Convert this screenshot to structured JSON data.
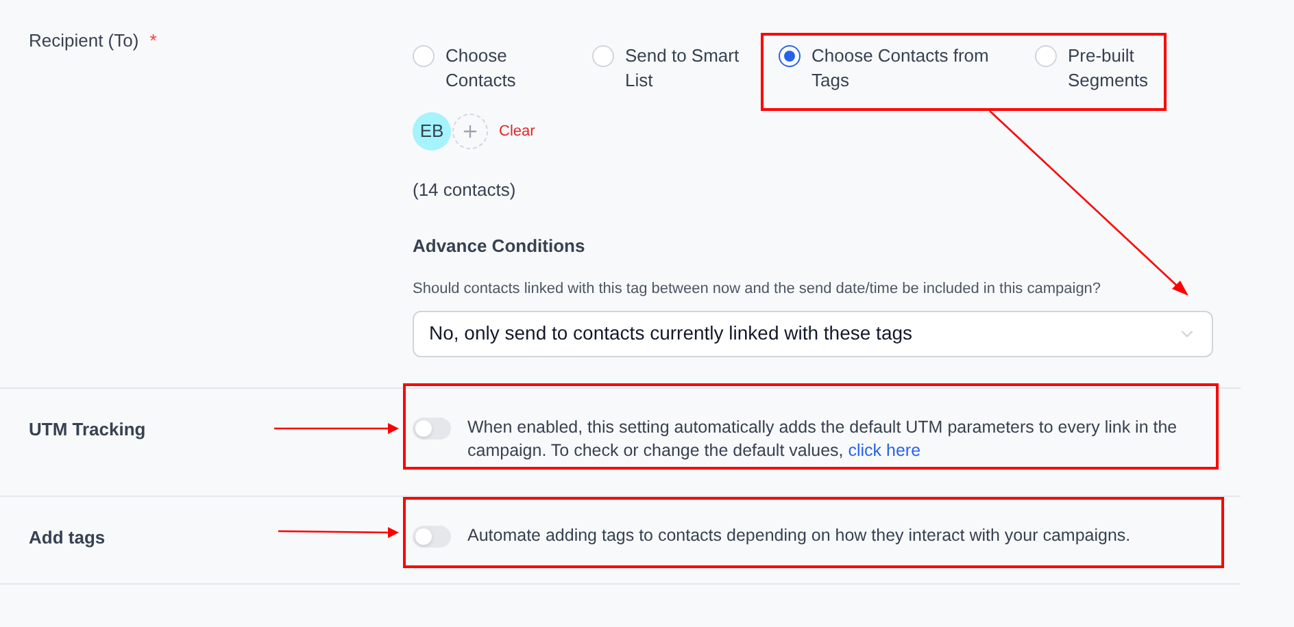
{
  "recipient": {
    "label": "Recipient (To)",
    "required_mark": "*",
    "options": [
      {
        "label": "Choose Contacts",
        "selected": false
      },
      {
        "label": "Send to Smart List",
        "selected": false
      },
      {
        "label": "Choose Contacts from Tags",
        "selected": true
      },
      {
        "label": "Pre-built Segments",
        "selected": false
      }
    ],
    "avatar": {
      "initials": "EB"
    },
    "clear": "Clear",
    "count": "(14 contacts)",
    "advance_title": "Advance Conditions",
    "question": "Should contacts linked with this tag between now and the send date/time be included in this campaign?",
    "select_value": "No, only send to contacts currently linked with these tags"
  },
  "settings": [
    {
      "label": "UTM Tracking",
      "on": false,
      "description": "When enabled, this setting automatically adds the default UTM parameters to every link in the campaign. To check or change the default values, ",
      "link": "click here"
    },
    {
      "label": "Add tags",
      "on": false,
      "description": "Automate adding tags to contacts depending on how they interact with your campaigns."
    }
  ]
}
